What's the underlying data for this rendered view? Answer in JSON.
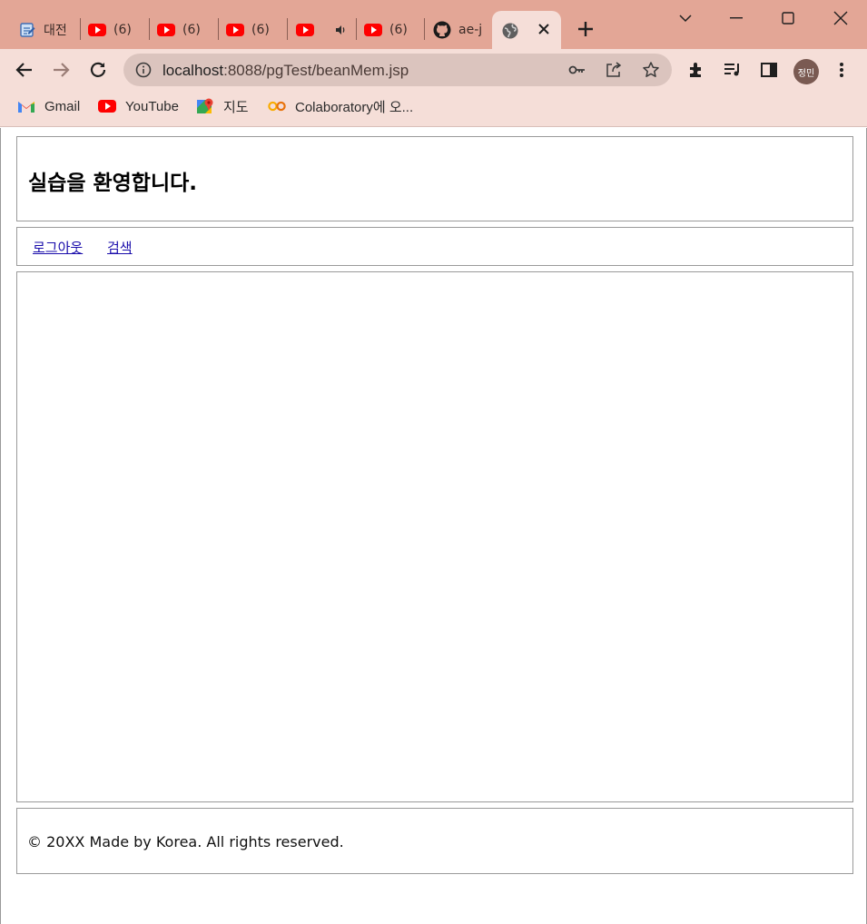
{
  "browser": {
    "tabs": [
      {
        "title": "대전",
        "icon": "notepad-icon"
      },
      {
        "title": "(6) ",
        "icon": "youtube-icon"
      },
      {
        "title": "(6) ",
        "icon": "youtube-icon"
      },
      {
        "title": "(6) ",
        "icon": "youtube-icon"
      },
      {
        "title": "",
        "icon": "youtube-icon",
        "audio": true
      },
      {
        "title": "(6) ",
        "icon": "youtube-icon"
      },
      {
        "title": "ae-j",
        "icon": "github-icon"
      },
      {
        "title": "",
        "icon": "globe-icon",
        "active": true
      }
    ],
    "url_host": "localhost",
    "url_rest": ":8088/pgTest/beanMem.jsp",
    "profile_initials": "정민",
    "bookmarks": [
      {
        "label": "Gmail",
        "icon": "gmail-icon"
      },
      {
        "label": "YouTube",
        "icon": "youtube-icon"
      },
      {
        "label": "지도",
        "icon": "maps-icon"
      },
      {
        "label": "Colaboratory에 오...",
        "icon": "colab-icon"
      }
    ],
    "colors": {
      "chrome_frame": "#e3a696",
      "toolbar": "#f5ded8",
      "omnibox": "#dbc4be"
    }
  },
  "page": {
    "heading": "실습을 환영합니다.",
    "nav": {
      "logout": "로그아웃",
      "search": "검색"
    },
    "footer": "© 20XX Made by Korea. All rights reserved."
  }
}
